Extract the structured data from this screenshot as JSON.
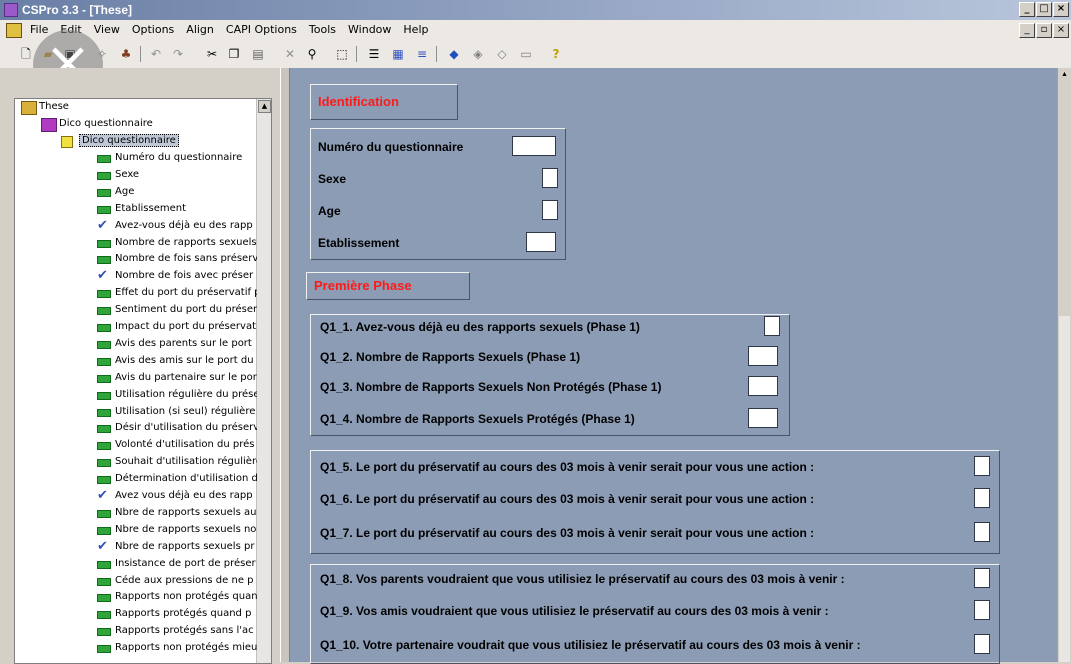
{
  "window": {
    "title": "CSPro 3.3 - [These]",
    "buttons": [
      "_",
      "□",
      "×"
    ],
    "mdi_buttons": [
      "_",
      "▫",
      "×"
    ]
  },
  "menu": [
    "File",
    "Edit",
    "View",
    "Options",
    "Align",
    "CAPI Options",
    "Tools",
    "Window",
    "Help"
  ],
  "tree": {
    "root": "These",
    "dictionary": "Dico questionnaire",
    "record": "Dico questionnaire",
    "items": [
      {
        "label": "Numéro du questionnaire",
        "icon": "green"
      },
      {
        "label": "Sexe",
        "icon": "green"
      },
      {
        "label": "Age",
        "icon": "green"
      },
      {
        "label": "Etablissement",
        "icon": "green"
      },
      {
        "label": "Avez-vous déjà eu des rapp",
        "icon": "check"
      },
      {
        "label": "Nombre de rapports sexuels",
        "icon": "green"
      },
      {
        "label": "Nombre de fois sans préserv",
        "icon": "green"
      },
      {
        "label": "Nombre de fois avec préser",
        "icon": "check"
      },
      {
        "label": "Effet du port du préservatif p",
        "icon": "green"
      },
      {
        "label": "Sentiment du port du préser",
        "icon": "green"
      },
      {
        "label": "Impact du port du préservati",
        "icon": "green"
      },
      {
        "label": "Avis des parents sur le port",
        "icon": "green"
      },
      {
        "label": "Avis des amis sur le port du",
        "icon": "green"
      },
      {
        "label": "Avis du partenaire sur le por",
        "icon": "green"
      },
      {
        "label": "Utilisation régulière du prése",
        "icon": "green"
      },
      {
        "label": "Utilisation (si seul) régulière",
        "icon": "green"
      },
      {
        "label": "Désir d'utilisation du préserv",
        "icon": "green"
      },
      {
        "label": "Volonté d'utilisation du prés",
        "icon": "green"
      },
      {
        "label": "Souhait d'utilisation régulière",
        "icon": "green"
      },
      {
        "label": "Détermination d'utilisation d",
        "icon": "green"
      },
      {
        "label": "Avez vous déjà eu des rapp",
        "icon": "check"
      },
      {
        "label": "Nbre de rapports sexuels au",
        "icon": "green"
      },
      {
        "label": "Nbre de rapports sexuels no",
        "icon": "green"
      },
      {
        "label": "Nbre de rapports sexuels pr",
        "icon": "check"
      },
      {
        "label": "Insistance de port de préser",
        "icon": "green"
      },
      {
        "label": "Céde aux pressions de ne p",
        "icon": "green"
      },
      {
        "label": "Rapports non protégés quan",
        "icon": "green"
      },
      {
        "label": "Rapports protégés quand p",
        "icon": "green"
      },
      {
        "label": "Rapports protégés sans l'ac",
        "icon": "green"
      },
      {
        "label": "Rapports non protégés mieu",
        "icon": "green"
      }
    ]
  },
  "form": {
    "identification": {
      "title": "Identification",
      "fields": [
        {
          "label": "Numéro du questionnaire",
          "size": "w3"
        },
        {
          "label": "Sexe",
          "size": "w1"
        },
        {
          "label": "Age",
          "size": "w1"
        },
        {
          "label": "Etablissement",
          "size": "w2"
        }
      ]
    },
    "phase1": {
      "title": "Première Phase",
      "group1": [
        {
          "label": "Q1_1. Avez-vous déjà eu des rapports sexuels (Phase 1)",
          "size": "w1"
        },
        {
          "label": "Q1_2. Nombre de Rapports Sexuels (Phase 1)",
          "size": "w2"
        },
        {
          "label": "Q1_3. Nombre de Rapports Sexuels Non Protégés (Phase 1)",
          "size": "w2"
        },
        {
          "label": "Q1_4. Nombre de Rapports Sexuels Protégés (Phase 1)",
          "size": "w2"
        }
      ],
      "group2": [
        {
          "label": "Q1_5. Le port du préservatif au cours des 03 mois à venir serait pour vous une action :"
        },
        {
          "label": "Q1_6. Le port du préservatif au cours des 03 mois à venir serait pour vous une action :"
        },
        {
          "label": "Q1_7. Le port du préservatif au cours des 03 mois à venir serait pour vous une action :"
        }
      ],
      "group3": [
        {
          "label": "Q1_8. Vos parents voudraient que vous utilisiez le préservatif au cours des 03 mois à venir :"
        },
        {
          "label": "Q1_9. Vos amis voudraient que vous utilisiez le préservatif au cours des 03 mois à venir :"
        },
        {
          "label": "Q1_10. Votre partenaire voudrait que vous utilisiez le préservatif au cours des 03 mois à venir :"
        }
      ]
    }
  },
  "colors": {
    "form_bg": "#8c9cb4",
    "section_title": "#ff1a1a"
  }
}
